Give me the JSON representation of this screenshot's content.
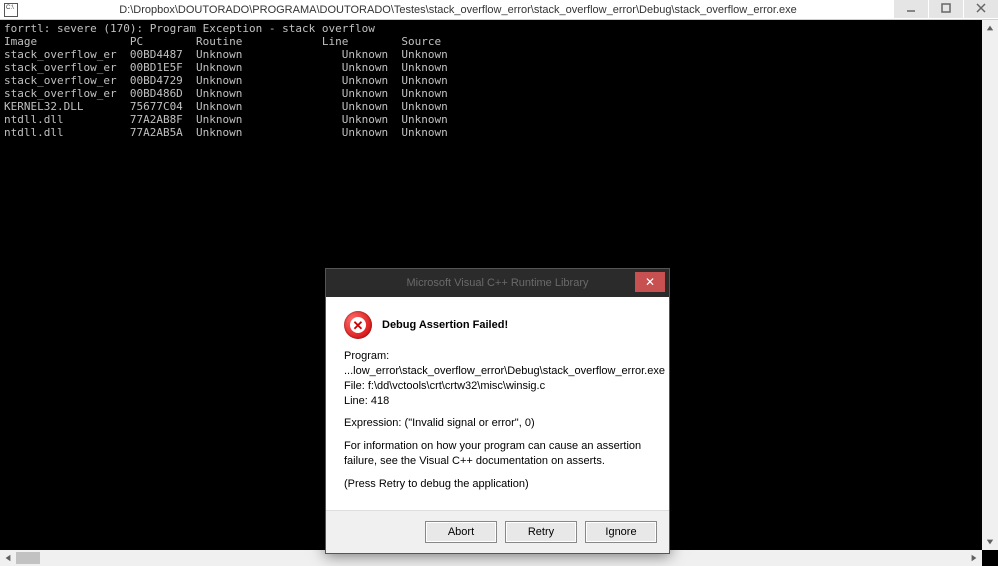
{
  "titlebar": {
    "title": "D:\\Dropbox\\DOUTORADO\\PROGRAMA\\DOUTORADO\\Testes\\stack_overflow_error\\stack_overflow_error\\Debug\\stack_overflow_error.exe"
  },
  "console": {
    "error_line": "forrtl: severe (170): Program Exception - stack overflow",
    "header": "Image              PC        Routine            Line        Source",
    "rows": [
      "stack_overflow_er  00BD4487  Unknown               Unknown  Unknown",
      "stack_overflow_er  00BD1E5F  Unknown               Unknown  Unknown",
      "stack_overflow_er  00BD4729  Unknown               Unknown  Unknown",
      "stack_overflow_er  00BD486D  Unknown               Unknown  Unknown",
      "KERNEL32.DLL       75677C04  Unknown               Unknown  Unknown",
      "ntdll.dll          77A2AB8F  Unknown               Unknown  Unknown",
      "ntdll.dll          77A2AB5A  Unknown               Unknown  Unknown"
    ]
  },
  "dialog": {
    "title": "Microsoft Visual C++ Runtime Library",
    "assert_title": "Debug Assertion Failed!",
    "program_label": "Program:",
    "program_path": "...low_error\\stack_overflow_error\\Debug\\stack_overflow_error.exe",
    "file_line": "File: f:\\dd\\vctools\\crt\\crtw32\\misc\\winsig.c",
    "line_line": "Line: 418",
    "expression": "Expression: (\"Invalid signal or error\", 0)",
    "info1": "For information on how your program can cause an assertion",
    "info2": "failure, see the Visual C++ documentation on asserts.",
    "retry_hint": "(Press Retry to debug the application)",
    "buttons": {
      "abort": "Abort",
      "retry": "Retry",
      "ignore": "Ignore"
    }
  }
}
